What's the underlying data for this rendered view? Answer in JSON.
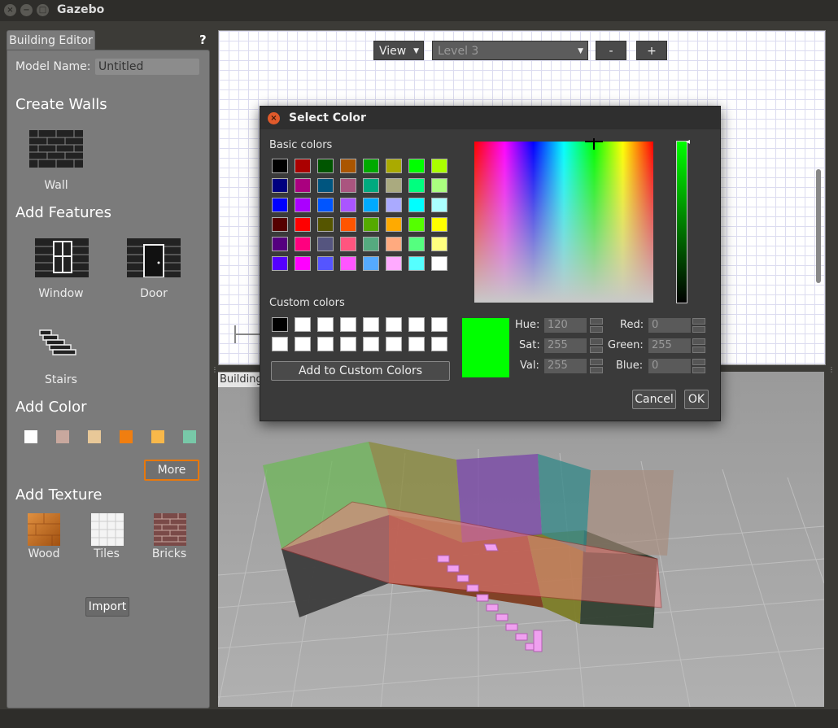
{
  "window": {
    "title": "Gazebo",
    "close": "×",
    "minimize": "−",
    "maximize": "□"
  },
  "left": {
    "tab": "Building Editor",
    "help": "?",
    "model_name_label": "Model Name:",
    "model_name_value": "Untitled",
    "create_walls": "Create Walls",
    "wall": "Wall",
    "add_features": "Add Features",
    "window": "Window",
    "door": "Door",
    "stairs": "Stairs",
    "add_color": "Add Color",
    "more": "More",
    "add_texture": "Add Texture",
    "wood": "Wood",
    "tiles": "Tiles",
    "bricks": "Bricks",
    "import": "Import",
    "swatches": [
      "#ffffff",
      "#c8a89e",
      "#e8c898",
      "#f07e10",
      "#f8b84a",
      "#78c8a8"
    ]
  },
  "editor": {
    "view": "View",
    "level": "Level 3",
    "minus": "-",
    "plus": "+"
  },
  "view3d": {
    "tab": "Building"
  },
  "dialog": {
    "title": "Select Color",
    "basic_colors": "Basic colors",
    "custom_colors": "Custom colors",
    "add_custom": "Add to Custom Colors",
    "hue_label": "Hue:",
    "sat_label": "Sat:",
    "val_label": "Val:",
    "red_label": "Red:",
    "green_label": "Green:",
    "blue_label": "Blue:",
    "hue": "120",
    "sat": "255",
    "val": "255",
    "red": "0",
    "green": "255",
    "blue": "0",
    "cancel": "Cancel",
    "ok": "OK",
    "selected_color": "#00ff00",
    "basic_palette": [
      [
        "#000000",
        "#aa0000",
        "#005500",
        "#aa5500",
        "#00aa00",
        "#aaaa00",
        "#00ff00",
        "#aaff00"
      ],
      [
        "#00007f",
        "#aa007f",
        "#00557f",
        "#aa557f",
        "#00aa7f",
        "#aaaa7f",
        "#00ff7f",
        "#aaff7f"
      ],
      [
        "#0000ff",
        "#aa00ff",
        "#0055ff",
        "#aa55ff",
        "#00aaff",
        "#aaaaff",
        "#00ffff",
        "#aaffff"
      ],
      [
        "#550000",
        "#ff0000",
        "#555500",
        "#ff5500",
        "#55aa00",
        "#ffaa00",
        "#55ff00",
        "#ffff00"
      ],
      [
        "#55007f",
        "#ff007f",
        "#55557f",
        "#ff557f",
        "#55aa7f",
        "#ffaa7f",
        "#55ff7f",
        "#ffff7f"
      ],
      [
        "#5500ff",
        "#ff00ff",
        "#5555ff",
        "#ff55ff",
        "#55aaff",
        "#ffaaff",
        "#55ffff",
        "#ffffff"
      ]
    ],
    "custom_palette": [
      [
        "#000000",
        "#ffffff",
        "#ffffff",
        "#ffffff",
        "#ffffff",
        "#ffffff",
        "#ffffff",
        "#ffffff"
      ],
      [
        "#ffffff",
        "#ffffff",
        "#ffffff",
        "#ffffff",
        "#ffffff",
        "#ffffff",
        "#ffffff",
        "#ffffff"
      ]
    ]
  }
}
